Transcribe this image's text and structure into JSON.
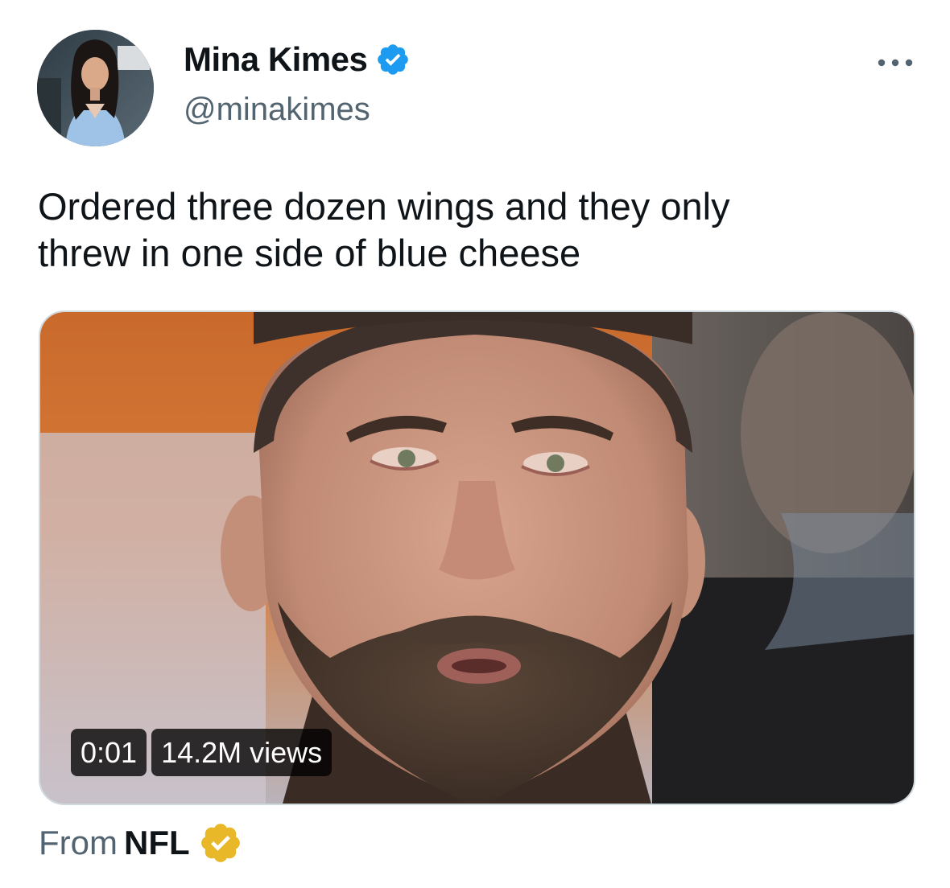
{
  "author": {
    "display_name": "Mina Kimes",
    "handle": "@minakimes",
    "verified_color": "#1d9bf0"
  },
  "tweet": {
    "text": "Ordered three dozen wings and they only\nthrew in one side of blue cheese"
  },
  "media": {
    "type": "video",
    "time": "0:01",
    "views": "14.2M views"
  },
  "attribution": {
    "from_label": "From",
    "source": "NFL",
    "verified_color": "#e8b829"
  },
  "icons": {
    "more": "more-horizontal-icon",
    "verified": "verified-badge-icon",
    "verified_org": "verified-org-badge-icon"
  }
}
